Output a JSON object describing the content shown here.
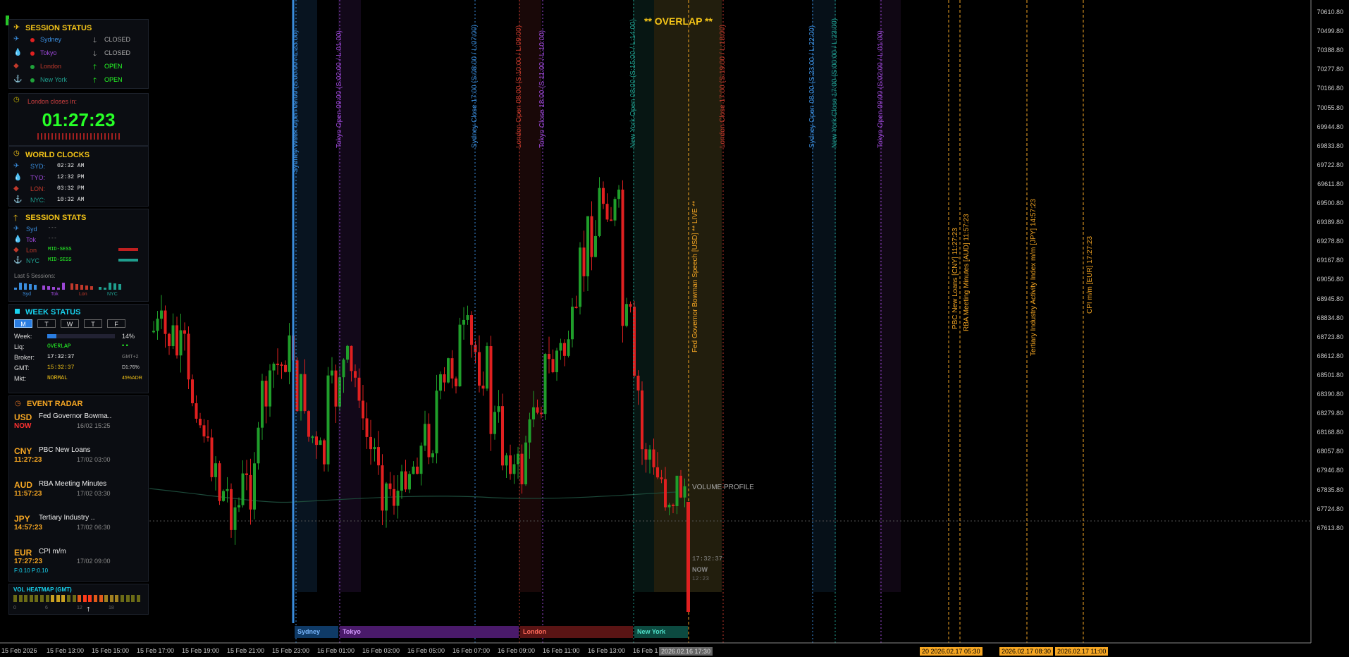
{
  "colors": {
    "sydney": "#3a8ddd",
    "tokyo": "#9b47d6",
    "london": "#c0392b",
    "newyork": "#1f9e8e",
    "orange": "#f5a623",
    "green": "#27ff27"
  },
  "session_status": {
    "title": "SESSION STATUS",
    "rows": [
      {
        "name": "Sydney",
        "state": "CLOSED",
        "color": "#3a8ddd",
        "dot": "#e02020",
        "arrow": "🡓"
      },
      {
        "name": "Tokyo",
        "state": "CLOSED",
        "color": "#9b47d6",
        "dot": "#e02020",
        "arrow": "🡓"
      },
      {
        "name": "London",
        "state": "OPEN",
        "color": "#c0392b",
        "dot": "#1fa23a",
        "arrow": "🡑"
      },
      {
        "name": "New York",
        "state": "OPEN",
        "color": "#1f9e8e",
        "dot": "#1fa23a",
        "arrow": "🡑"
      }
    ]
  },
  "countdown": {
    "label": "London closes in:",
    "time": "01:27:23"
  },
  "world_clocks": {
    "title": "WORLD CLOCKS",
    "rows": [
      {
        "label": "SYD:",
        "time": "02:32 AM",
        "color": "#3a8ddd"
      },
      {
        "label": "TYO:",
        "time": "12:32 PM",
        "color": "#9b47d6"
      },
      {
        "label": "LON:",
        "time": "03:32 PM",
        "color": "#c0392b"
      },
      {
        "label": "NYC:",
        "time": "10:32 AM",
        "color": "#1f9e8e"
      }
    ]
  },
  "session_stats": {
    "title": "SESSION STATS",
    "rows": [
      {
        "label": "Syd",
        "value": "---",
        "color": "#3a8ddd"
      },
      {
        "label": "Tok",
        "value": "---",
        "color": "#9b47d6"
      },
      {
        "label": "Lon",
        "value": "MID-SESS",
        "color": "#c0392b"
      },
      {
        "label": "NYC",
        "value": "MID-SESS",
        "color": "#1f9e8e"
      }
    ],
    "last5_label": "Last 5 Sessions:",
    "last5": [
      {
        "label": "Syd",
        "color": "#3a8ddd"
      },
      {
        "label": "Tok",
        "color": "#9b47d6"
      },
      {
        "label": "Lon",
        "color": "#c0392b"
      },
      {
        "label": "NYC",
        "color": "#1f9e8e"
      }
    ]
  },
  "week_status": {
    "title": "WEEK STATUS",
    "days": [
      "M",
      "T",
      "W",
      "T",
      "F"
    ],
    "active_day_index": 0,
    "week_label": "Week:",
    "week_pct": "14%",
    "week_progress": 0.14,
    "liq_label": "Liq:",
    "liq_value": "OVERLAP",
    "broker_label": "Broker:",
    "broker_time": "17:32:37",
    "broker_tz": "GMT+2",
    "gmt_label": "GMT:",
    "gmt_time": "15:32:37",
    "gmt_extra": "D1:76%",
    "mkt_label": "Mkt:",
    "mkt_value": "NORMAL",
    "mkt_extra": "45%ADR"
  },
  "event_radar": {
    "title": "EVENT RADAR",
    "events": [
      {
        "ccy": "USD",
        "name": "Fed Governor Bowma..",
        "countdown": "NOW",
        "date": "16/02 15:25",
        "cd_color": "#ff3030"
      },
      {
        "ccy": "CNY",
        "name": "PBC New Loans",
        "countdown": "11:27:23",
        "date": "17/02 03:00",
        "cd_color": "#f5a623"
      },
      {
        "ccy": "AUD",
        "name": "RBA Meeting Minutes",
        "countdown": "11:57:23",
        "date": "17/02 03:30",
        "cd_color": "#f5a623"
      },
      {
        "ccy": "JPY",
        "name": "Tertiary Industry ..",
        "countdown": "14:57:23",
        "date": "17/02 06:30",
        "cd_color": "#f5a623"
      },
      {
        "ccy": "EUR",
        "name": "CPI m/m",
        "countdown": "17:27:23",
        "date": "17/02 09:00",
        "cd_color": "#f5a623",
        "extra": "F:0.10  P:0.10"
      }
    ]
  },
  "vol_heatmap": {
    "title": "VOL HEATMAP (GMT)",
    "ticks": [
      "0",
      "6",
      "12",
      "18"
    ]
  },
  "chart_data": {
    "type": "candlestick",
    "y_ticks": [
      "70610.80",
      "70499.80",
      "70388.80",
      "70277.80",
      "70166.80",
      "70055.80",
      "69944.80",
      "69833.80",
      "69722.80",
      "69611.80",
      "69500.80",
      "69389.80",
      "69278.80",
      "69167.80",
      "69056.80",
      "68945.80",
      "68834.80",
      "68723.80",
      "68612.80",
      "68501.80",
      "68390.80",
      "68279.80",
      "68168.80",
      "68057.80",
      "67946.80",
      "67835.80",
      "67724.80",
      "67613.80"
    ],
    "x_ticks": [
      "15 Feb 2026",
      "15 Feb 13:00",
      "15 Feb 15:00",
      "15 Feb 17:00",
      "15 Feb 19:00",
      "15 Feb 21:00",
      "15 Feb 23:00",
      "16 Feb 01:00",
      "16 Feb 03:00",
      "16 Feb 05:00",
      "16 Feb 07:00",
      "16 Feb 09:00",
      "16 Feb 11:00",
      "16 Feb 13:00",
      "16 Feb 1"
    ],
    "cursor_time": "2026.02.16 17:30",
    "overlap_label": "** OVERLAP **",
    "volume_profile_label": "VOLUME PROFILE",
    "now_time": "17:32:37",
    "now_label": "NOW",
    "now_sub": "12:23",
    "session_lines": [
      {
        "text": "Sydney Week Open 09:00 (S:00:00 / L:23:00)",
        "color": "#3a8ddd"
      },
      {
        "text": "Tokyo Open 09:00 (S:02:00 / L:01:00)",
        "color": "#9b47d6"
      },
      {
        "text": "Sydney Close 17:00 (S:08:00 / L:07:00)",
        "color": "#3a8ddd"
      },
      {
        "text": "London Open 08:00 (S:10:00 / L:09:00)",
        "color": "#c0392b"
      },
      {
        "text": "Tokyo Close 18:00 (S:11:00 / L:10:00)",
        "color": "#9b47d6"
      },
      {
        "text": "New York Open 08:00 (S:15:00 / L:14:00)",
        "color": "#1f9e8e"
      },
      {
        "text": "London Close 17:00 (S:19:00 / L:18:00)",
        "color": "#c0392b"
      },
      {
        "text": "Sydney Open 08:00 (S:23:00 / L:22:00)",
        "color": "#3a8ddd"
      },
      {
        "text": "New York Close 17:00 (S:00:00 / L:23:00)",
        "color": "#1f9e8e"
      },
      {
        "text": "Tokyo Open 09:00 (S:02:00 / L:01:00)",
        "color": "#9b47d6"
      }
    ],
    "event_lines": [
      {
        "text": "Fed Governor Bowman Speech [USD]  ** LIVE **"
      },
      {
        "text": "PBC New Loans [CNY]  11:27:23"
      },
      {
        "text": "RBA Meeting Minutes [AUD]  11:57:23"
      },
      {
        "text": "Tertiary Industry Activity Index m/m [JPY]  14:57:23"
      },
      {
        "text": "CPI m/m [EUR]  17:27:23"
      }
    ],
    "event_tags": [
      "20 2026.02.17 05:30",
      "2026.02.17 08:30",
      "2026.02.17 11:00"
    ],
    "session_bars": [
      "Sydney",
      "Tokyo",
      "London",
      "New York"
    ]
  }
}
